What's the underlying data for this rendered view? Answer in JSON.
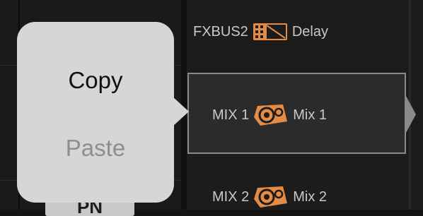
{
  "popup_menu": {
    "copy_label": "Copy",
    "paste_label": "Paste"
  },
  "left_panel": {
    "bottom_button_label": "PN"
  },
  "routing_rows": [
    {
      "bus": "FXBUS2",
      "icon": "effects-rack-icon",
      "name": "Delay"
    },
    {
      "bus": "MIX 1",
      "icon": "wedge-monitor-icon",
      "name": "Mix 1",
      "selected": true
    },
    {
      "bus": "MIX 2",
      "icon": "wedge-monitor-icon",
      "name": "Mix 2"
    }
  ],
  "colors": {
    "background": "#141414",
    "popup": "#d6d6d6",
    "icon_orange": "#e58b44",
    "selection_border": "#8a8a8a",
    "label_text": "#c9c9c9",
    "paste_disabled": "#8e8e8e"
  }
}
